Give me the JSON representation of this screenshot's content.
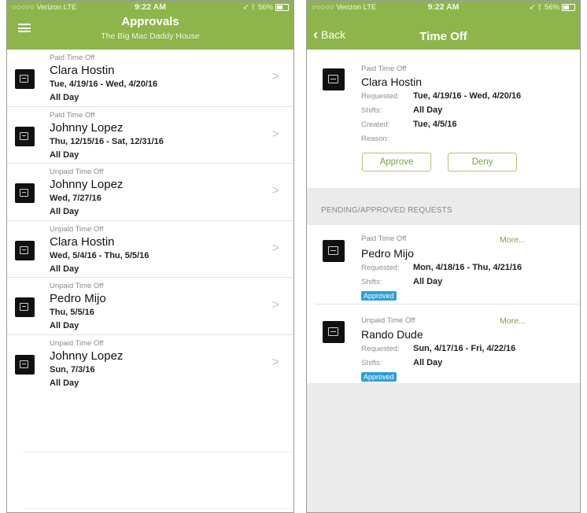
{
  "statusbar": {
    "carrier": "○○○○○ Verizon  LTE",
    "time": "9:22 AM",
    "battery": "56%",
    "icons": [
      "location-icon",
      "bluetooth-icon",
      "battery-icon"
    ]
  },
  "left": {
    "title": "Approvals",
    "subtitle": "The Big Mac Daddy House",
    "menu_icon": "hamburger-icon",
    "rows": [
      {
        "type": "Paid Time Off",
        "name": "Clara Hostin",
        "dates": "Tue, 4/19/16 - Wed, 4/20/16",
        "shift": "All Day"
      },
      {
        "type": "Paid Time Off",
        "name": "Johnny Lopez",
        "dates": "Thu, 12/15/16 - Sat, 12/31/16",
        "shift": "All Day"
      },
      {
        "type": "Unpaid Time Off",
        "name": "Johnny Lopez",
        "dates": "Wed, 7/27/16",
        "shift": "All Day"
      },
      {
        "type": "Unpaid Time Off",
        "name": "Clara Hostin",
        "dates": "Wed, 5/4/16 - Thu, 5/5/16",
        "shift": "All Day"
      },
      {
        "type": "Unpaid Time Off",
        "name": "Pedro Mijo",
        "dates": "Thu, 5/5/16",
        "shift": "All Day"
      },
      {
        "type": "Unpaid Time Off",
        "name": "Johnny Lopez",
        "dates": "Sun, 7/3/16",
        "shift": "All Day"
      }
    ],
    "chevron": ">"
  },
  "right": {
    "title": "Time Off",
    "back_label": "Back",
    "detail": {
      "type": "Paid Time Off",
      "name": "Clara Hostin",
      "requested_label": "Requested:",
      "requested": "Tue, 4/19/16 - Wed, 4/20/16",
      "shifts_label": "Shifts:",
      "shifts": "All Day",
      "created_label": "Created:",
      "created": "Tue, 4/5/16",
      "reason_label": "Reason:",
      "approve_label": "Approve",
      "deny_label": "Deny"
    },
    "section_header": "PENDING/APPROVED REQUESTS",
    "requests": [
      {
        "type": "Paid Time Off",
        "name": "Pedro Mijo",
        "requested_label": "Requested:",
        "requested": "Mon, 4/18/16 - Thu, 4/21/16",
        "shifts_label": "Shifts:",
        "shifts": "All Day",
        "status": "Approved",
        "more": "More..."
      },
      {
        "type": "Unpaid Time Off",
        "name": "Rando Dude",
        "requested_label": "Requested:",
        "requested": "Sun, 4/17/16 - Fri, 4/22/16",
        "shifts_label": "Shifts:",
        "shifts": "All Day",
        "status": "Approved",
        "more": "More..."
      }
    ]
  },
  "colors": {
    "accent": "#8db54b",
    "badge": "#2f9fd6",
    "button_text": "#7ea43f"
  }
}
